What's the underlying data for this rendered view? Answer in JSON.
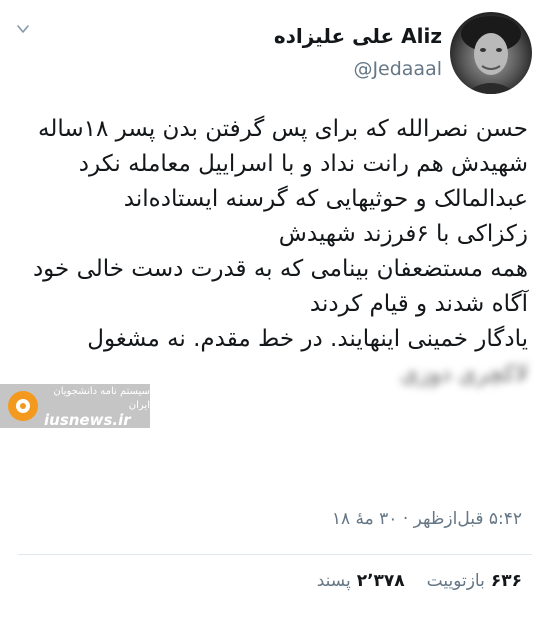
{
  "header": {
    "display_name": "علی علیزاده Aliz",
    "handle": "@Jedaaal",
    "menu_icon": "chevron-down-icon",
    "avatar_icon": "profile-photo"
  },
  "tweet": {
    "lines": [
      "حسن نصرالله که برای پس گرفتن بدن پسر ۱۸ساله شهیدش هم رانت نداد و با اسراییل معامله نکرد",
      "عبدالمالک و حوثیهایی که گرسنه ایستاده‌اند",
      "زکزاکی با ۶فرزند شهیدش",
      "همه مستضعفان بینامی که به قدرت دست خالی خود آگاه شدند و قیام کردند",
      "یادگار خمینی اینهایند. در خط مقدم. نه مشغول",
      "لاکچری دوزی"
    ]
  },
  "watermark": {
    "line1": "سیستم نامه دانشجویان ایران",
    "site": "iusnews.ir"
  },
  "meta": {
    "timestamp": "۵:۴۲ قبل‌ازظهر · ۳۰ مهٔ ۱۸"
  },
  "stats": {
    "retweets_count": "۶۳۶",
    "retweets_label": "بازتوییت",
    "likes_count": "۲٬۳۷۸",
    "likes_label": "پسند"
  },
  "colors": {
    "text": "#14171a",
    "secondary": "#657786",
    "divider": "#e1e8ed",
    "watermark_orange": "#f39a1e"
  }
}
